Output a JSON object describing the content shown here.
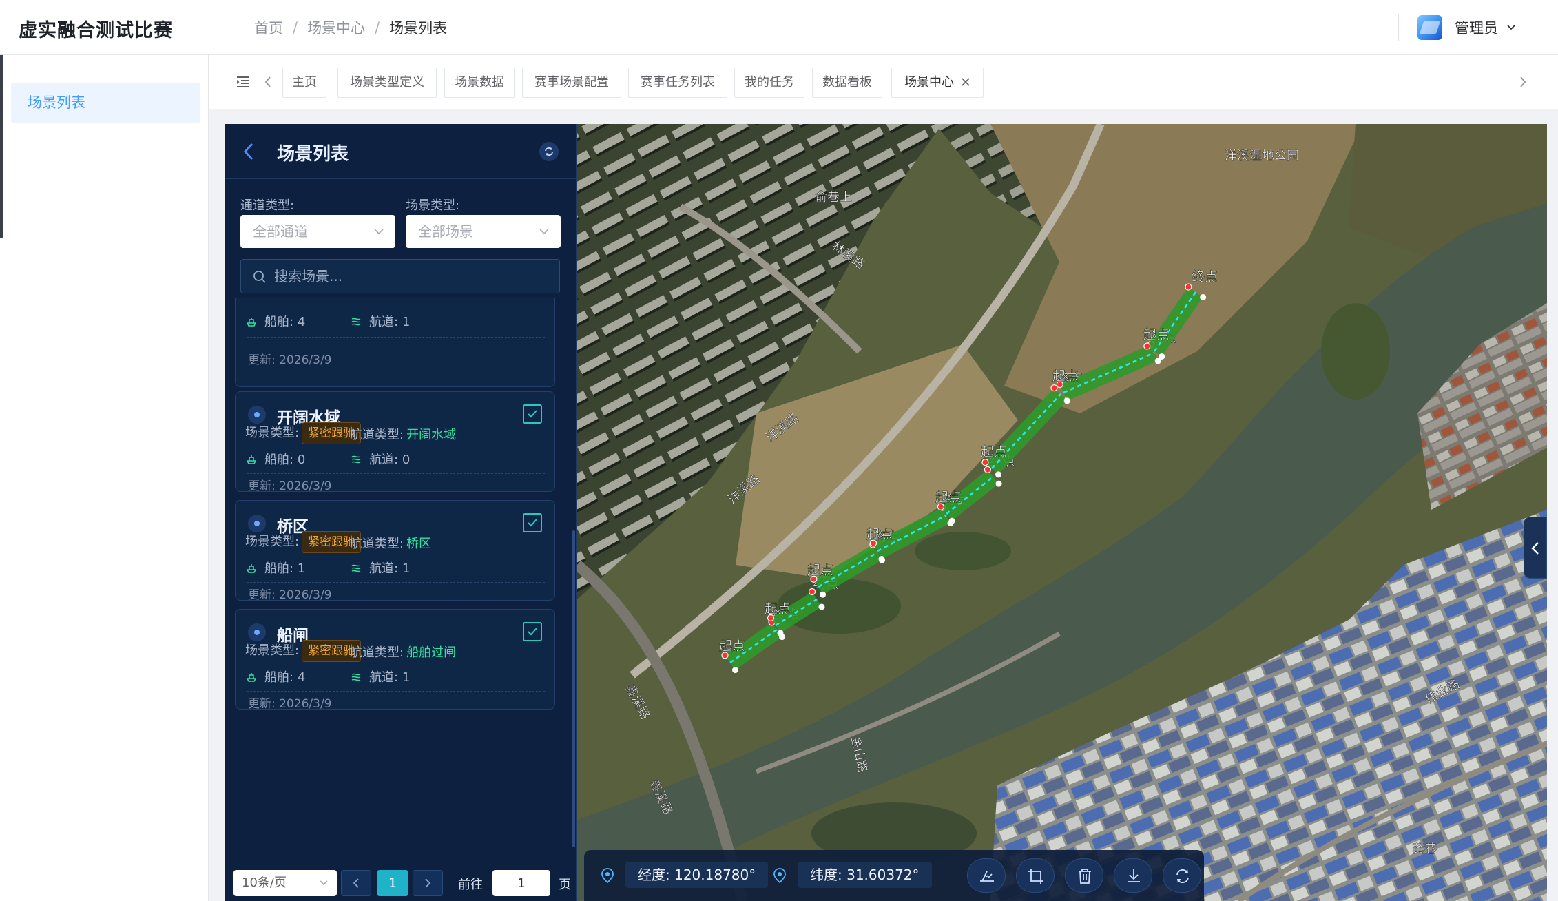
{
  "app": {
    "title": "虚实融合测试比赛"
  },
  "breadcrumb": {
    "items": [
      "首页",
      "场景中心",
      "场景列表"
    ],
    "separator": "/"
  },
  "user": {
    "name": "管理员"
  },
  "sidebar": {
    "items": [
      {
        "label": "场景列表",
        "active": true
      }
    ]
  },
  "tabs": [
    {
      "label": "主页",
      "active": false
    },
    {
      "label": "场景类型定义",
      "active": false
    },
    {
      "label": "场景数据",
      "active": false
    },
    {
      "label": "赛事场景配置",
      "active": false
    },
    {
      "label": "赛事任务列表",
      "active": false
    },
    {
      "label": "我的任务",
      "active": false
    },
    {
      "label": "数据看板",
      "active": false
    },
    {
      "label": "场景中心",
      "active": true,
      "closable": true
    }
  ],
  "panel": {
    "title": "场景列表",
    "filters": {
      "channel_label": "通道类型:",
      "channel_value": "全部通道",
      "scene_label": "场景类型:",
      "scene_value": "全部场景"
    },
    "search_placeholder": "搜索场景..."
  },
  "labels": {
    "scene_type": "场景类型:",
    "channel_type": "航道类型:",
    "ships": "船舶:",
    "channels": "航道:"
  },
  "scenes": [
    {
      "title": "",
      "scene_type": "",
      "channel_type": "",
      "ships": "4",
      "channels": "1",
      "updated": "更新: 2026/3/9",
      "checked": true,
      "partial": true
    },
    {
      "title": "开阔水域",
      "scene_type": "紧密跟驰",
      "channel_type": "开阔水域",
      "ships": "0",
      "channels": "0",
      "updated": "更新: 2026/3/9",
      "checked": true
    },
    {
      "title": "桥区",
      "scene_type": "紧密跟驰",
      "channel_type": "桥区",
      "ships": "1",
      "channels": "1",
      "updated": "更新: 2026/3/9",
      "checked": true
    },
    {
      "title": "船闸",
      "scene_type": "紧密跟驰",
      "channel_type": "船舶过闸",
      "ships": "4",
      "channels": "1",
      "updated": "更新: 2026/3/9",
      "checked": true
    }
  ],
  "pagination": {
    "page_size": "10条/页",
    "current_page": "1",
    "goto_label": "前往",
    "goto_value": "1",
    "page_unit": "页"
  },
  "map": {
    "place_labels": [
      "洋溪湿地公园",
      "俞巷上",
      "林溪路",
      "洋溪路",
      "洋溪路",
      "鑫溪路",
      "鑫溪路",
      "金山路",
      "伟业路",
      "龚巷"
    ],
    "waypoint_start": "起点",
    "waypoint_end": "终点",
    "coords": {
      "lng": "经度: 120.18780°",
      "lat": "纬度: 31.60372°"
    },
    "tools": [
      "measure-tool",
      "crop-tool",
      "delete-tool",
      "download-tool",
      "refresh-tool"
    ]
  },
  "colors": {
    "accent": "#409eff",
    "panel_bg": "#0d2040",
    "badge": "#f0a432",
    "success": "#2ee6a2",
    "route": "#2e9a2a",
    "check": "#2ec7c0"
  }
}
